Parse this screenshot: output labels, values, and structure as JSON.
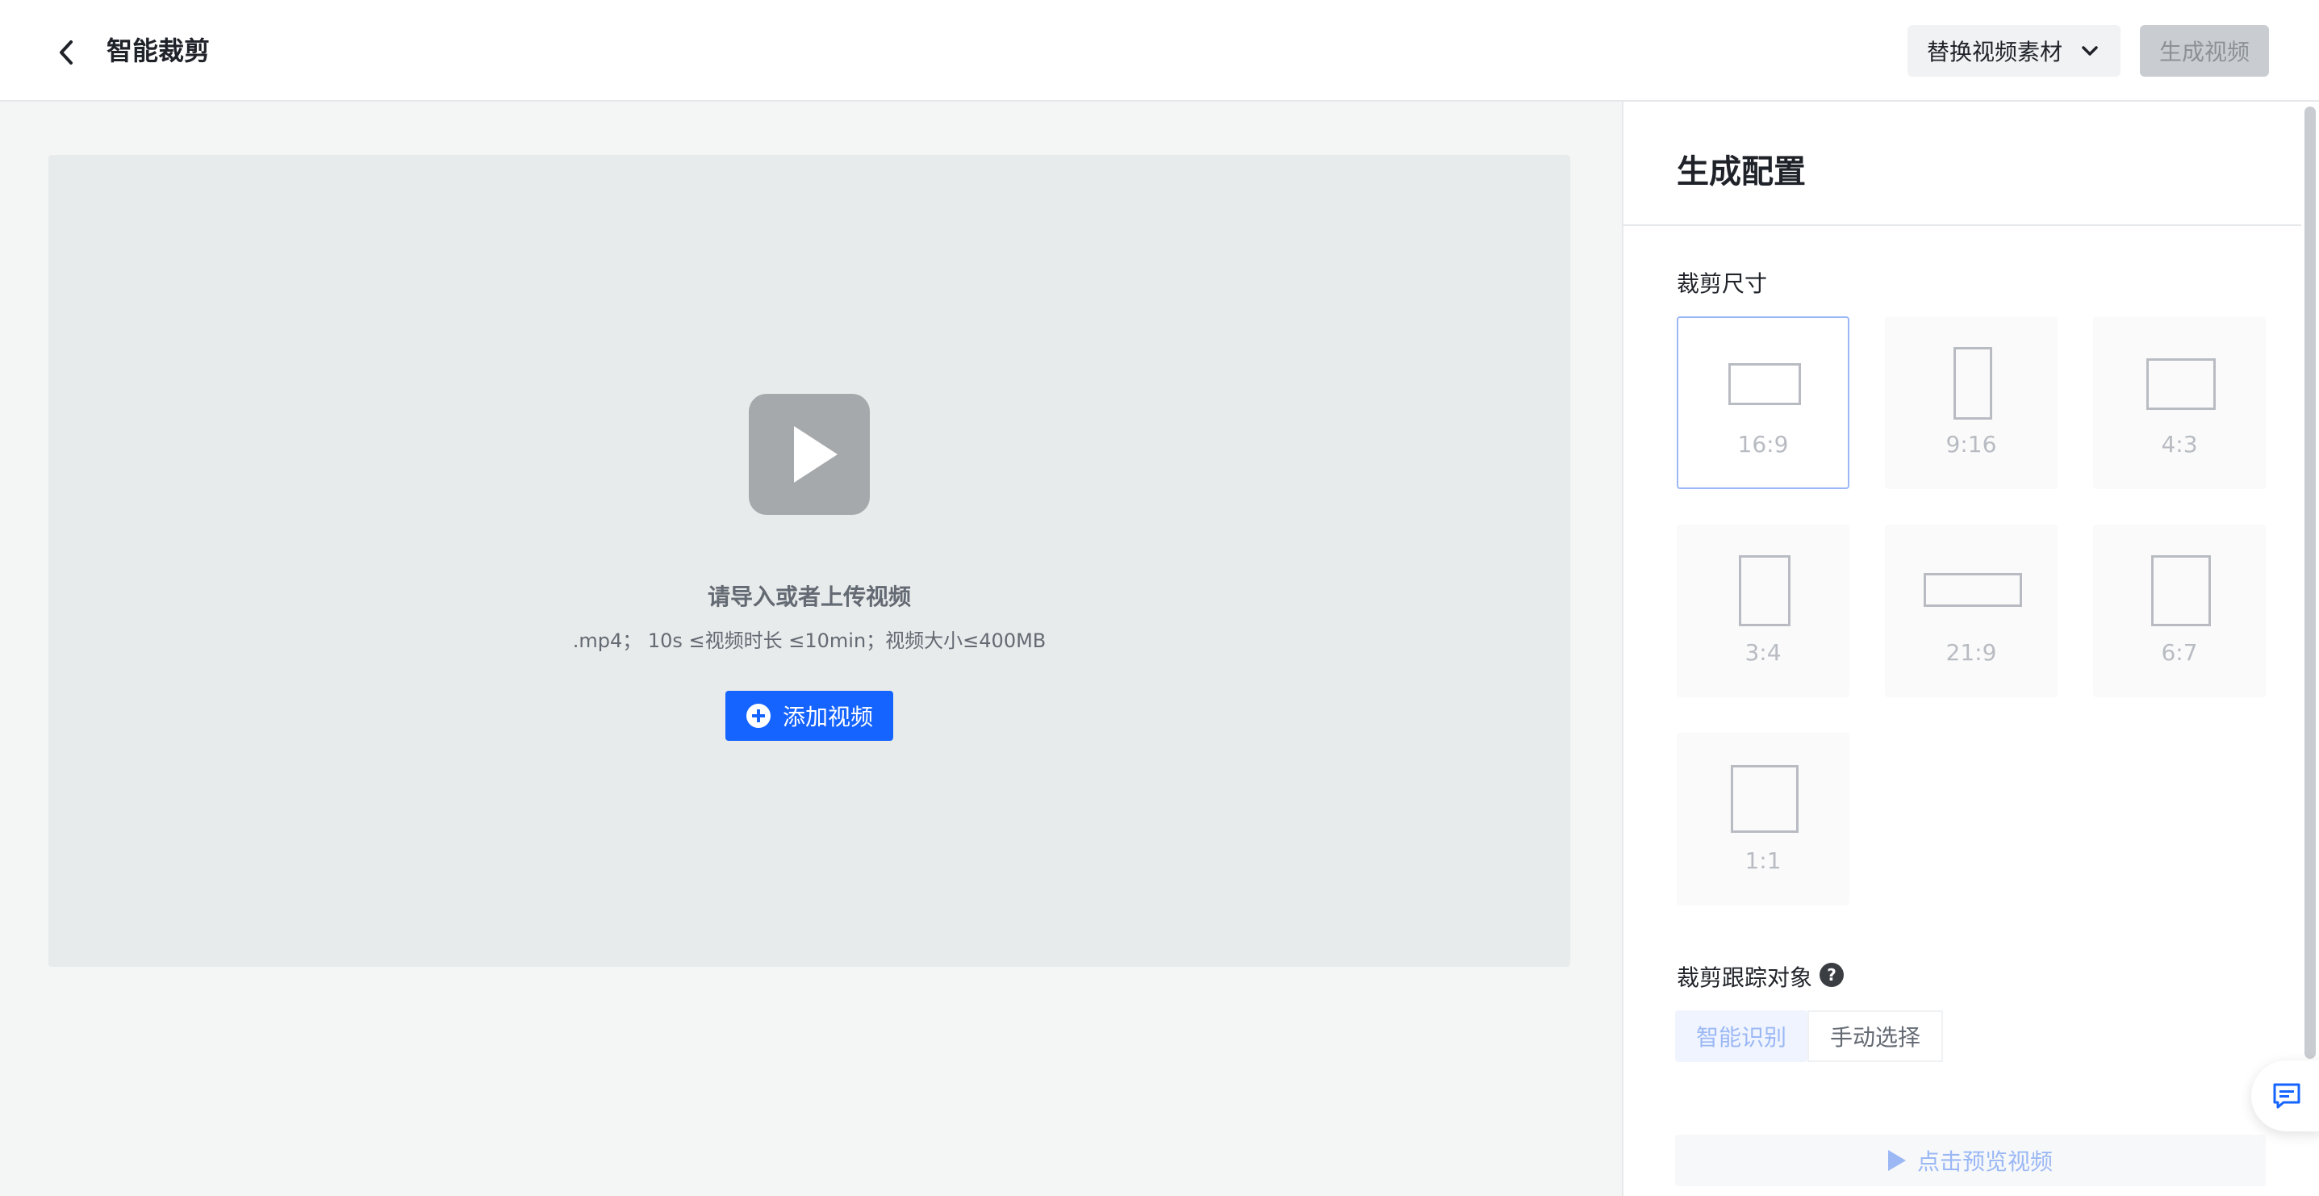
{
  "header": {
    "title": "智能裁剪",
    "replace_label": "替换视频素材",
    "generate_label": "生成视频"
  },
  "upload": {
    "title": "请导入或者上传视频",
    "hint": ".mp4； 10s ≤视频时长 ≤10min；视频大小≤400MB",
    "add_label": "添加视频"
  },
  "panel": {
    "title": "生成配置",
    "crop_size_label": "裁剪尺寸",
    "ratios": [
      {
        "label": "16:9",
        "selected": true
      },
      {
        "label": "9:16",
        "selected": false
      },
      {
        "label": "4:3",
        "selected": false
      },
      {
        "label": "3:4",
        "selected": false
      },
      {
        "label": "21:9",
        "selected": false
      },
      {
        "label": "6:7",
        "selected": false
      },
      {
        "label": "1:1",
        "selected": false
      }
    ],
    "track_label": "裁剪跟踪对象",
    "track_tabs": [
      {
        "label": "智能识别",
        "active": true
      },
      {
        "label": "手动选择",
        "active": false
      }
    ],
    "preview_label": "点击预览视频"
  },
  "colors": {
    "accent": "#1664ff",
    "selected_border": "#9bb8f5",
    "disabled_bg": "#c9cdd1"
  },
  "icons": {
    "back": "chevron-left-icon",
    "dropdown": "chevron-down-icon",
    "play": "play-icon",
    "add": "plus-circle-icon",
    "help": "question-circle-icon",
    "preview": "play-triangle-icon",
    "feedback": "feedback-chat-icon"
  }
}
